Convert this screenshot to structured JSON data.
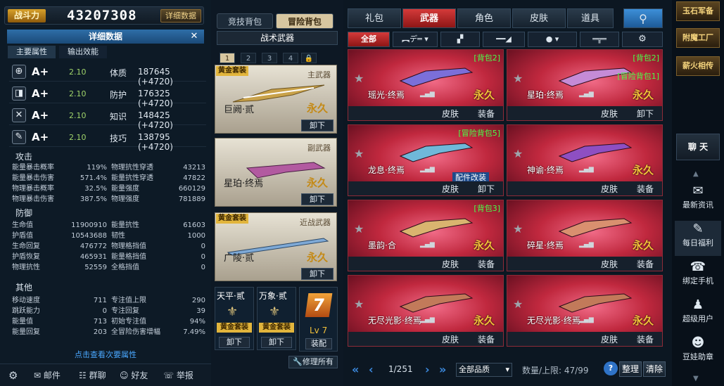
{
  "header": {
    "combat_power_label": "战斗力",
    "combat_power_value": "43207308",
    "detail_button": "详细数据"
  },
  "detail_panel": {
    "title": "详细数据",
    "close_label": "✕",
    "tabs": [
      "主要属性",
      "输出效能"
    ],
    "stats": [
      {
        "icon": "⊕",
        "grade": "A+",
        "level": "2.10",
        "name": "体质",
        "value": "187645 (+4720)"
      },
      {
        "icon": "◨",
        "grade": "A+",
        "level": "2.10",
        "name": "防护",
        "value": "176325 (+4720)"
      },
      {
        "icon": "✕",
        "grade": "A+",
        "level": "2.10",
        "name": "知识",
        "value": "148425 (+4720)"
      },
      {
        "icon": "✎",
        "grade": "A+",
        "level": "2.10",
        "name": "技巧",
        "value": "138795 (+4720)"
      }
    ],
    "sections": {
      "attack": "攻击",
      "defense": "防御",
      "other": "其他"
    },
    "attack_rows": [
      [
        "能量暴击概率",
        "119%",
        "物理抗性穿透",
        "43213"
      ],
      [
        "能量暴击伤害",
        "571.4%",
        "能量抗性穿透",
        "47822"
      ],
      [
        "物理暴击概率",
        "32.5%",
        "能量强度",
        "660129"
      ],
      [
        "物理暴击伤害",
        "387.5%",
        "物理强度",
        "781889"
      ]
    ],
    "defense_rows": [
      [
        "生命值",
        "11900910",
        "能量抗性",
        "61603"
      ],
      [
        "护盾值",
        "10543688",
        "韧性",
        "1000"
      ],
      [
        "生命回复",
        "476772",
        "物理格挡值",
        "0"
      ],
      [
        "护盾恢复",
        "465931",
        "能量格挡值",
        "0"
      ],
      [
        "物理抗性",
        "52559",
        "全格挡值",
        "0"
      ]
    ],
    "other_rows": [
      [
        "移动速度",
        "711",
        "专注值上限",
        "290"
      ],
      [
        "跳跃能力",
        "0",
        "专注回复",
        "39"
      ],
      [
        "能量值",
        "713",
        "初始专注值",
        "94%"
      ],
      [
        "能量回复",
        "203",
        "全冒险伤害增幅",
        "7.49%"
      ]
    ],
    "more_link": "点击查看次要属性"
  },
  "bottom_bar": {
    "settings_icon": "gear-icon",
    "mail": "邮件",
    "group_chat": "群聊",
    "friends": "好友",
    "report": "举报"
  },
  "loadout": {
    "bag_tabs": [
      "竞技背包",
      "冒险背包"
    ],
    "tactical_title": "战术武器",
    "slot_tabs": [
      "1",
      "2",
      "3",
      "4"
    ],
    "slots": [
      {
        "badge": "黄金套装",
        "category": "主武器",
        "weapon": "巨阙·贰",
        "permanent": "永久",
        "action": "卸下"
      },
      {
        "badge": "",
        "category": "副武器",
        "weapon": "星珀·终焉",
        "permanent": "永久",
        "action": "卸下"
      },
      {
        "badge": "黄金套装",
        "category": "近战武器",
        "weapon": "广陵·贰",
        "permanent": "永久",
        "action": "卸下"
      }
    ],
    "mini_slots": [
      {
        "name": "天平·贰",
        "badge": "黄金套装",
        "action": "卸下"
      },
      {
        "name": "万象·贰",
        "badge": "黄金套装",
        "action": "卸下"
      }
    ],
    "level_slot": {
      "level": "Lv 7",
      "action": "装配"
    },
    "repair_all": "修理所有"
  },
  "store": {
    "top_tabs": [
      "礼包",
      "武器",
      "角色",
      "皮肤",
      "道具"
    ],
    "filter_all": "全部",
    "cards": [
      {
        "name": "瑶光·终焉",
        "bag": "[背包2]",
        "bag2": "",
        "permanent": "永久",
        "skin": "皮肤",
        "action": "装备",
        "mod": ""
      },
      {
        "name": "星珀·终焉",
        "bag": "[背包2]",
        "bag2": "[冒险背包1]",
        "permanent": "永久",
        "skin": "皮肤",
        "action": "卸下",
        "mod": ""
      },
      {
        "name": "龙息·终焉",
        "bag": "[冒险背包5]",
        "bag2": "",
        "permanent": "",
        "skin": "皮肤",
        "action": "卸下",
        "mod": "配件改装"
      },
      {
        "name": "神谕·终焉",
        "bag": "",
        "bag2": "",
        "permanent": "永久",
        "skin": "皮肤",
        "action": "装备",
        "mod": ""
      },
      {
        "name": "墨韵·合",
        "bag": "[背包3]",
        "bag2": "",
        "permanent": "永久",
        "skin": "皮肤",
        "action": "装备",
        "mod": ""
      },
      {
        "name": "碎星·终焉",
        "bag": "",
        "bag2": "",
        "permanent": "永久",
        "skin": "皮肤",
        "action": "装备",
        "mod": ""
      },
      {
        "name": "无尽光影·终焉",
        "bag": "",
        "bag2": "",
        "permanent": "永久",
        "skin": "皮肤",
        "action": "装备",
        "mod": ""
      },
      {
        "name": "无尽光影·终焉",
        "bag": "",
        "bag2": "",
        "permanent": "永久",
        "skin": "皮肤",
        "action": "装备",
        "mod": ""
      }
    ],
    "pager": {
      "page": "1/251",
      "quality": "全部品质",
      "capacity": "数量/上限: 47/99",
      "help": "?",
      "sort": "整理",
      "clear": "清除"
    }
  },
  "sidebar": {
    "top_items": [
      "玉石军备",
      "附魔工厂",
      "薪火相传"
    ],
    "chat": "聊 天",
    "items": [
      {
        "icon": "✉",
        "label": "最新资讯"
      },
      {
        "icon": "✎",
        "label": "每日福利"
      },
      {
        "icon": "☎",
        "label": "绑定手机"
      },
      {
        "icon": "♟",
        "label": "超级用户"
      },
      {
        "icon": "☻",
        "label": "豆娃助章"
      }
    ]
  },
  "colors": {
    "accent_red": "#d43a3a",
    "gold": "#e2b53c",
    "bag_green": "#49ff49",
    "link_blue": "#4aa8ff"
  }
}
